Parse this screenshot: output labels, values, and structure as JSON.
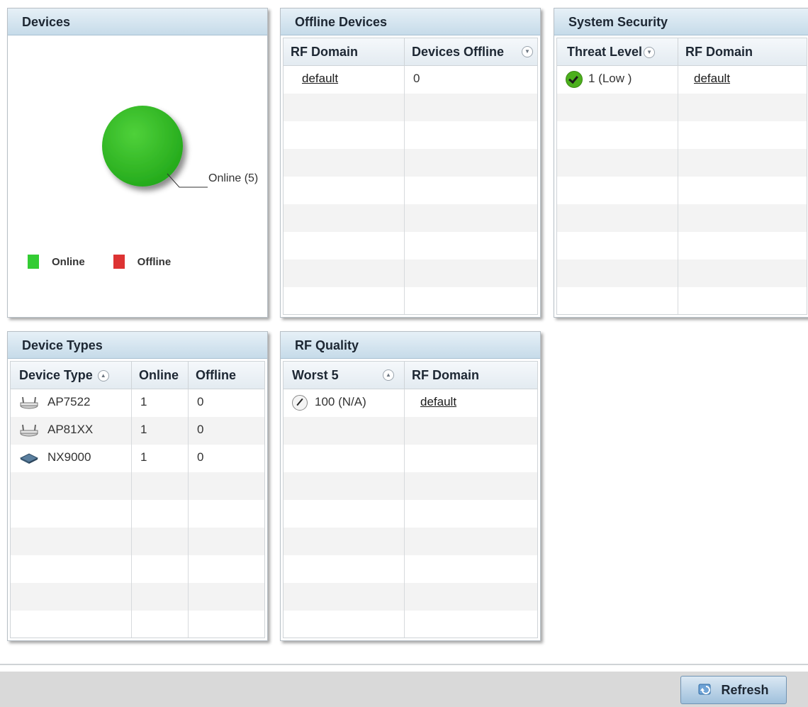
{
  "devices": {
    "title": "Devices",
    "pie_label": "Online (5)",
    "legend": [
      {
        "label": "Online",
        "color": "#33cc33"
      },
      {
        "label": "Offline",
        "color": "#dd3333"
      }
    ]
  },
  "offline_devices": {
    "title": "Offline Devices",
    "columns": [
      "RF Domain",
      "Devices Offline"
    ],
    "rows": [
      {
        "rf_domain": "default",
        "devices_offline": "0"
      }
    ]
  },
  "system_security": {
    "title": "System Security",
    "columns": [
      "Threat Level",
      "RF Domain"
    ],
    "rows": [
      {
        "threat_level": "1 (Low )",
        "rf_domain": "default"
      }
    ]
  },
  "device_types": {
    "title": "Device Types",
    "columns": [
      "Device Type",
      "Online",
      "Offline"
    ],
    "rows": [
      {
        "type": "AP7522",
        "online": "1",
        "offline": "0",
        "icon": "access-point-icon"
      },
      {
        "type": "AP81XX",
        "online": "1",
        "offline": "0",
        "icon": "access-point-icon"
      },
      {
        "type": "NX9000",
        "online": "1",
        "offline": "0",
        "icon": "controller-icon"
      }
    ]
  },
  "rf_quality": {
    "title": "RF Quality",
    "columns": [
      "Worst 5",
      "RF Domain"
    ],
    "rows": [
      {
        "worst": "100 (N/A)",
        "rf_domain": "default"
      }
    ]
  },
  "footer": {
    "refresh_label": "Refresh"
  }
}
